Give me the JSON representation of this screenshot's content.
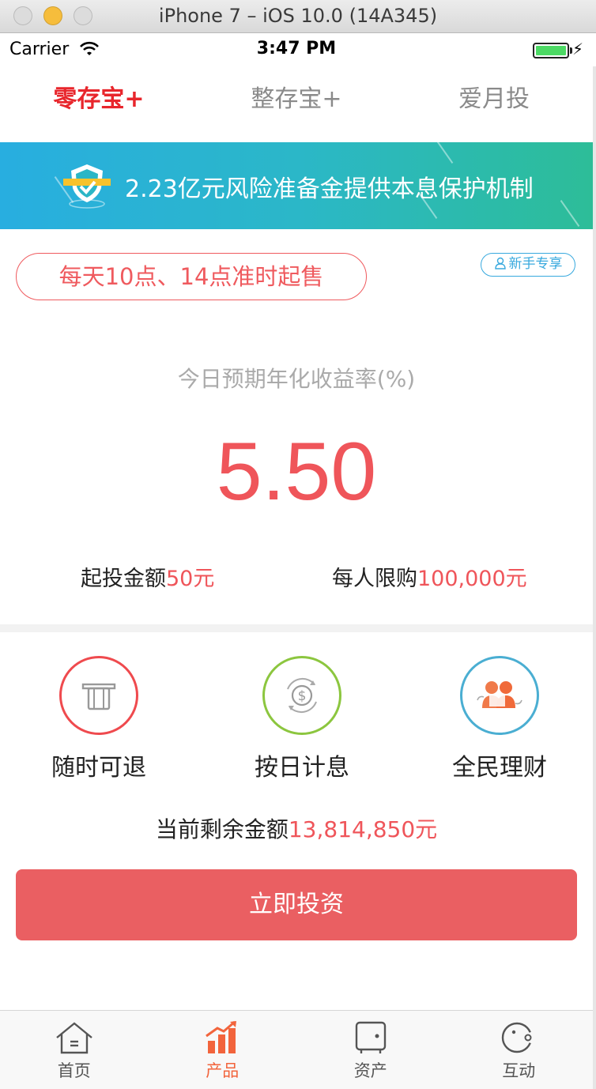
{
  "window": {
    "title": "iPhone 7 – iOS 10.0 (14A345)"
  },
  "status_bar": {
    "carrier": "Carrier",
    "time": "3:47 PM",
    "battery": "full"
  },
  "top_tabs": [
    {
      "label": "零存宝+",
      "active": true
    },
    {
      "label": "整存宝+",
      "active": false
    },
    {
      "label": "爱月投",
      "active": false
    }
  ],
  "banner": {
    "text": "2.23亿元风险准备金提供本息保护机制",
    "icon": "shield-icon"
  },
  "product": {
    "sale_time": "每天10点、14点准时起售",
    "newbie_badge": "新手专享",
    "rate_label": "今日预期年化收益率(%)",
    "rate_value": "5.50",
    "min_invest_label": "起投金额",
    "min_invest_value": "50元",
    "limit_label": "每人限购",
    "limit_value": "100,000元"
  },
  "features": [
    {
      "label": "随时可退",
      "icon": "card-icon",
      "color": "#ef4a4e"
    },
    {
      "label": "按日计息",
      "icon": "dollar-coin-icon",
      "color": "#8cc63f"
    },
    {
      "label": "全民理财",
      "icon": "people-icon",
      "color": "#4aaed2"
    }
  ],
  "remaining": {
    "label": "当前剩余金额",
    "value": "13,814,850元"
  },
  "invest_button": {
    "label": "立即投资"
  },
  "tab_bar": [
    {
      "label": "首页",
      "icon": "home-icon",
      "active": false
    },
    {
      "label": "产品",
      "icon": "bar-chart-icon",
      "active": true
    },
    {
      "label": "资产",
      "icon": "safe-icon",
      "active": false
    },
    {
      "label": "互动",
      "icon": "chat-face-icon",
      "active": false
    }
  ],
  "colors": {
    "accent_red": "#ef555a",
    "tab_active": "#f2643c",
    "banner_start": "#28aee0",
    "banner_end": "#2dbd98"
  }
}
